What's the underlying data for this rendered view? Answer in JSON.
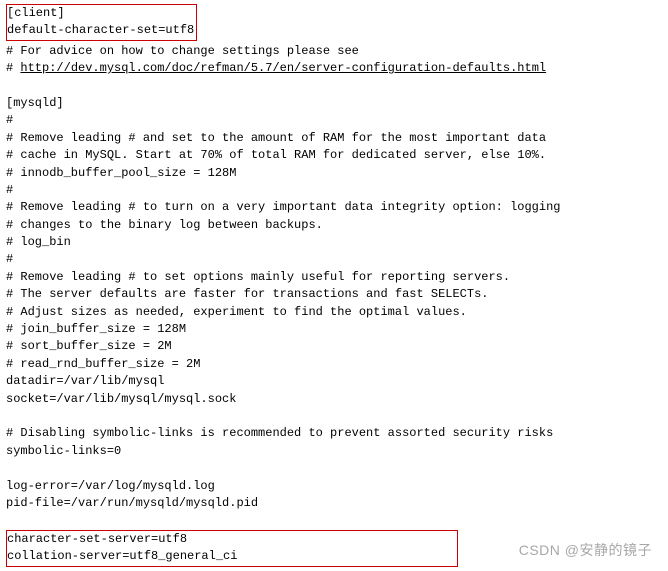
{
  "top_box": {
    "l1": "[client]",
    "l2": "default-character-set=utf8"
  },
  "lines": {
    "l01": "# For advice on how to change settings please see",
    "l02_prefix": "# ",
    "l02_url": "http://dev.mysql.com/doc/refman/5.7/en/server-configuration-defaults.html",
    "l03": "",
    "l04": "[mysqld]",
    "l05": "#",
    "l06": "# Remove leading # and set to the amount of RAM for the most important data",
    "l07": "# cache in MySQL. Start at 70% of total RAM for dedicated server, else 10%.",
    "l08": "# innodb_buffer_pool_size = 128M",
    "l09": "#",
    "l10": "# Remove leading # to turn on a very important data integrity option: logging",
    "l11": "# changes to the binary log between backups.",
    "l12": "# log_bin",
    "l13": "#",
    "l14": "# Remove leading # to set options mainly useful for reporting servers.",
    "l15": "# The server defaults are faster for transactions and fast SELECTs.",
    "l16": "# Adjust sizes as needed, experiment to find the optimal values.",
    "l17": "# join_buffer_size = 128M",
    "l18": "# sort_buffer_size = 2M",
    "l19": "# read_rnd_buffer_size = 2M",
    "l20": "datadir=/var/lib/mysql",
    "l21": "socket=/var/lib/mysql/mysql.sock",
    "l22": "",
    "l23": "# Disabling symbolic-links is recommended to prevent assorted security risks",
    "l24": "symbolic-links=0",
    "l25": "",
    "l26": "log-error=/var/log/mysqld.log",
    "l27": "pid-file=/var/run/mysqld/mysqld.pid",
    "l28": ""
  },
  "bottom_box": {
    "l1": "character-set-server=utf8",
    "l2": "collation-server=utf8_general_ci"
  },
  "watermark": "CSDN @安静的镜子"
}
